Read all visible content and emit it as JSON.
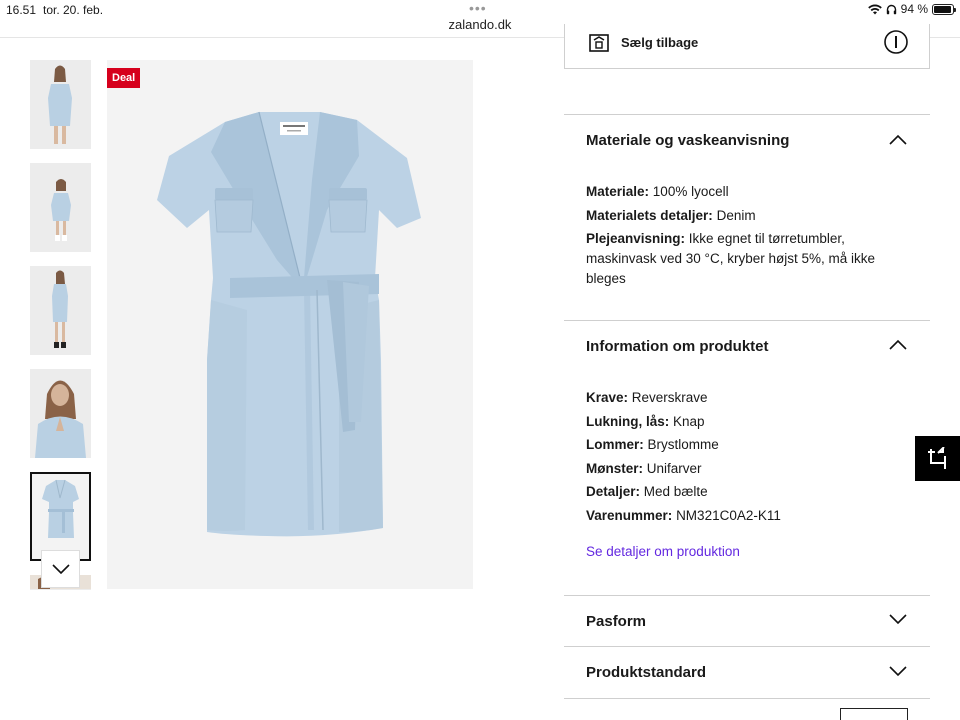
{
  "status": {
    "time": "16.51",
    "date": "tor. 20. feb.",
    "dots": "•••",
    "url": "zalando.dk",
    "battery": "94 %"
  },
  "gallery": {
    "deal_badge": "Deal",
    "thumb_count": 6,
    "active_thumb": 5
  },
  "sell": {
    "label": "Sælg tilbage",
    "icon": "store-icon"
  },
  "sections": {
    "material": {
      "title": "Materiale og vaskeanvisning",
      "expanded": true,
      "rows": [
        {
          "key": "Materiale:",
          "value": "100% lyocell"
        },
        {
          "key": "Materialets detaljer:",
          "value": "Denim"
        },
        {
          "key": "Plejeanvisning:",
          "value": "Ikke egnet til tørretumbler, maskinvask ved 30 °C, kryber højst 5%, må ikke bleges"
        }
      ]
    },
    "info": {
      "title": "Information om produktet",
      "expanded": true,
      "rows": [
        {
          "key": "Krave:",
          "value": "Reverskrave"
        },
        {
          "key": "Lukning, lås:",
          "value": "Knap"
        },
        {
          "key": "Lommer:",
          "value": "Brystlomme"
        },
        {
          "key": "Mønster:",
          "value": "Unifarver"
        },
        {
          "key": "Detaljer:",
          "value": "Med bælte"
        },
        {
          "key": "Varenummer:",
          "value": "NM321C0A2-K11"
        }
      ],
      "link": "Se detaljer om produktion"
    },
    "fit": {
      "title": "Pasform",
      "expanded": false
    },
    "standard": {
      "title": "Produktstandard",
      "expanded": false
    }
  },
  "colors": {
    "deal": "#d6001c",
    "link": "#6328e0",
    "dress": "#b9d0e3"
  }
}
